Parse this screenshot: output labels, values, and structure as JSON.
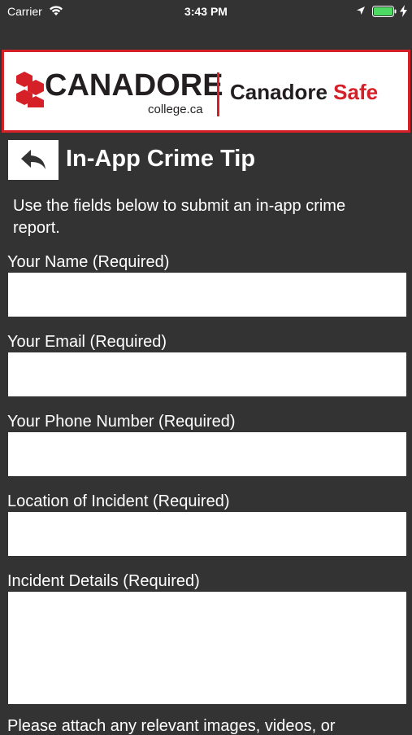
{
  "status_bar": {
    "carrier": "Carrier",
    "time": "3:43 PM"
  },
  "header": {
    "logo_name": "CANADORE",
    "logo_sub": "college.ca",
    "app_name_prefix": "Canadore",
    "app_name_suffix": "Safe",
    "accent_color": "#d42026"
  },
  "page": {
    "title": "In-App Crime Tip",
    "intro": "Use the fields below to submit an in-app crime report."
  },
  "form": {
    "name_label": "Your Name (Required)",
    "name_value": "",
    "email_label": "Your Email (Required)",
    "email_value": "",
    "phone_label": "Your Phone Number (Required)",
    "phone_value": "",
    "location_label": "Location of Incident (Required)",
    "location_value": "",
    "details_label": "Incident Details (Required)",
    "details_value": "",
    "attach_text": "Please attach any relevant images, videos, or"
  },
  "icons": {
    "back": "back-arrow-icon",
    "wifi": "wifi-icon",
    "location": "location-arrow-icon",
    "battery": "battery-icon",
    "charging": "charging-bolt-icon",
    "logo": "canadore-logo-mark"
  }
}
